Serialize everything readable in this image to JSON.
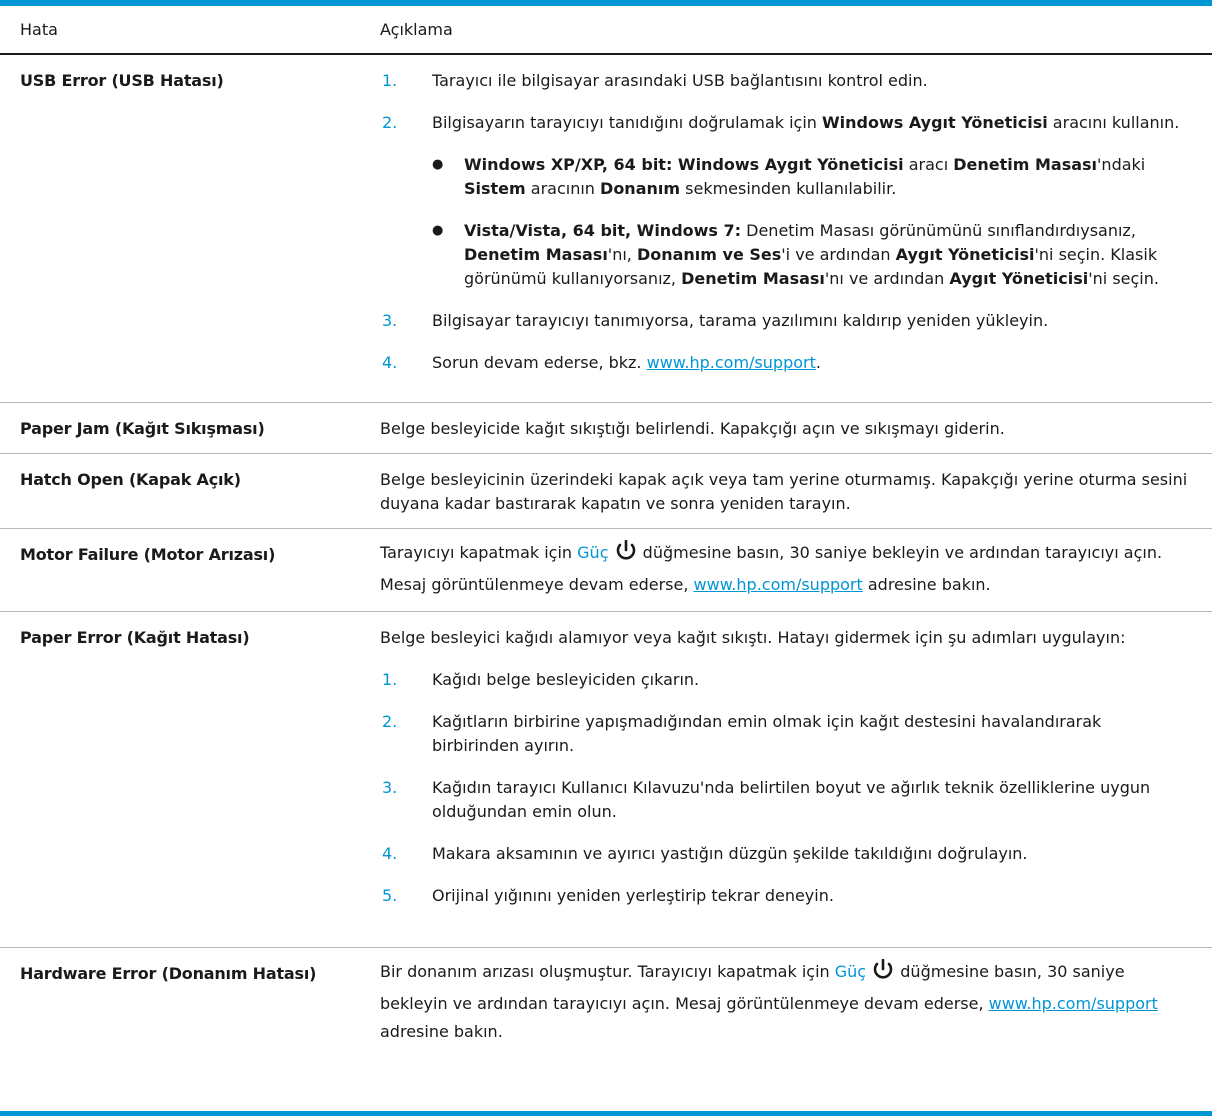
{
  "header": {
    "col1": "Hata",
    "col2": "Açıklama"
  },
  "rows": {
    "usb": {
      "title": "USB Error (USB Hatası)",
      "s1": {
        "num": "1.",
        "text": "Tarayıcı ile bilgisayar arasındaki USB bağlantısını kontrol edin."
      },
      "s2": {
        "num": "2.",
        "pre": "Bilgisayarın tarayıcıyı tanıdığını doğrulamak için ",
        "bold": "Windows Aygıt Yöneticisi",
        "post": " aracını kullanın."
      },
      "b1": {
        "bullet": "●",
        "bold1": "Windows XP/XP, 64 bit: Windows Aygıt Yöneticisi",
        "t1": " aracı ",
        "bold2": "Denetim Masası",
        "t2": "'ndaki ",
        "bold3": "Sistem",
        "t3": " aracının ",
        "bold4": "Donanım",
        "t4": " sekmesinden kullanılabilir."
      },
      "b2": {
        "bullet": "●",
        "bold1": "Vista/Vista, 64 bit, Windows 7:",
        "t1": " Denetim Masası görünümünü sınıflandırdıysanız, ",
        "bold2": "Denetim Masası",
        "t2": "'nı, ",
        "bold3": "Donanım ve Ses",
        "t3": "'i ve ardından ",
        "bold4": "Aygıt Yöneticisi",
        "t4": "'ni seçin. Klasik görünümü kullanıyorsanız, ",
        "bold5": "Denetim Masası",
        "t5": "'nı ve ardından ",
        "bold6": "Aygıt Yöneticisi",
        "t6": "'ni seçin."
      },
      "s3": {
        "num": "3.",
        "text": "Bilgisayar tarayıcıyı tanımıyorsa, tarama yazılımını kaldırıp yeniden yükleyin."
      },
      "s4": {
        "num": "4.",
        "pre": "Sorun devam ederse, bkz. ",
        "link": "www.hp.com/support",
        "post": "."
      }
    },
    "jam": {
      "title": "Paper Jam (Kağıt Sıkışması)",
      "text": "Belge besleyicide kağıt sıkıştığı belirlendi. Kapakçığı açın ve sıkışmayı giderin."
    },
    "hatch": {
      "title": "Hatch Open (Kapak Açık)",
      "text": "Belge besleyicinin üzerindeki kapak açık veya tam yerine oturmamış. Kapakçığı yerine oturma sesini duyana kadar bastırarak kapatın ve sonra yeniden tarayın."
    },
    "motor": {
      "title": "Motor Failure (Motor Arızası)",
      "pre": "Tarayıcıyı kapatmak için ",
      "power_label": "Güç",
      "mid": " düğmesine basın, 30 saniye bekleyin ve ardından tarayıcıyı açın. Mesaj görüntülenmeye devam ederse, ",
      "link": "www.hp.com/support",
      "post": " adresine bakın."
    },
    "paper": {
      "title": "Paper Error (Kağıt Hatası)",
      "intro": "Belge besleyici kağıdı alamıyor veya kağıt sıkıştı. Hatayı gidermek için şu adımları uygulayın:",
      "s1": {
        "num": "1.",
        "text": "Kağıdı belge besleyiciden çıkarın."
      },
      "s2": {
        "num": "2.",
        "text": "Kağıtların birbirine yapışmadığından emin olmak için kağıt destesini havalandırarak birbirinden ayırın."
      },
      "s3": {
        "num": "3.",
        "text": "Kağıdın tarayıcı Kullanıcı Kılavuzu'nda belirtilen boyut ve ağırlık teknik özelliklerine uygun olduğundan emin olun."
      },
      "s4": {
        "num": "4.",
        "text": "Makara aksamının ve ayırıcı yastığın düzgün şekilde takıldığını doğrulayın."
      },
      "s5": {
        "num": "5.",
        "text": "Orijinal yığınını yeniden yerleştirip tekrar deneyin."
      }
    },
    "hardware": {
      "title": "Hardware Error (Donanım Hatası)",
      "pre": "Bir donanım arızası oluşmuştur. Tarayıcıyı kapatmak için ",
      "power_label": "Güç",
      "mid": " düğmesine basın, 30 saniye bekleyin ve ardından tarayıcıyı açın. Mesaj görüntülenmeye devam ederse, ",
      "link": "www.hp.com/support",
      "post": " adresine bakın."
    }
  },
  "colors": {
    "accent": "#0096d6",
    "text": "#1a1a1a",
    "rule": "#b8b8b8"
  },
  "icons": {
    "power": "power-icon"
  }
}
